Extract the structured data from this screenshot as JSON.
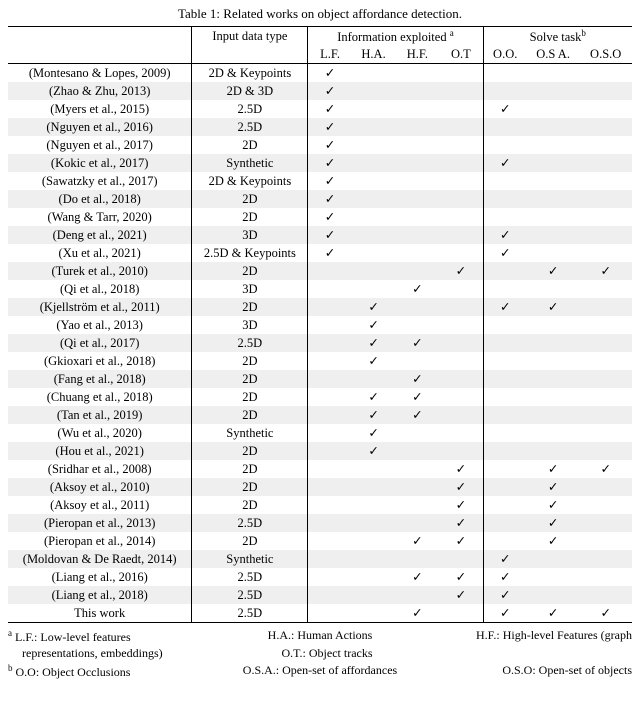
{
  "caption": "Table 1: Related works on object affordance detection.",
  "header": {
    "group1": "Input data type",
    "group2": "Information exploited",
    "group2_sup": "a",
    "group3": "Solve task",
    "group3_sup": "b",
    "c_lf": "L.F.",
    "c_ha": "H.A.",
    "c_hf": "H.F.",
    "c_ot": "O.T",
    "c_oo": "O.O.",
    "c_osa": "O.S A.",
    "c_oso": "O.S.O"
  },
  "chart_data": {
    "type": "table",
    "columns": [
      "reference",
      "input",
      "LF",
      "HA",
      "HF",
      "OT",
      "OO",
      "OSA",
      "OSO"
    ],
    "rows": [
      {
        "reference": "(Montesano & Lopes, 2009)",
        "input": "2D & Keypoints",
        "LF": true,
        "HA": false,
        "HF": false,
        "OT": false,
        "OO": false,
        "OSA": false,
        "OSO": false
      },
      {
        "reference": "(Zhao & Zhu, 2013)",
        "input": "2D & 3D",
        "LF": true,
        "HA": false,
        "HF": false,
        "OT": false,
        "OO": false,
        "OSA": false,
        "OSO": false
      },
      {
        "reference": "(Myers et al., 2015)",
        "input": "2.5D",
        "LF": true,
        "HA": false,
        "HF": false,
        "OT": false,
        "OO": true,
        "OSA": false,
        "OSO": false
      },
      {
        "reference": "(Nguyen et al., 2016)",
        "input": "2.5D",
        "LF": true,
        "HA": false,
        "HF": false,
        "OT": false,
        "OO": false,
        "OSA": false,
        "OSO": false
      },
      {
        "reference": "(Nguyen et al., 2017)",
        "input": "2D",
        "LF": true,
        "HA": false,
        "HF": false,
        "OT": false,
        "OO": false,
        "OSA": false,
        "OSO": false
      },
      {
        "reference": "(Kokic et al., 2017)",
        "input": "Synthetic",
        "LF": true,
        "HA": false,
        "HF": false,
        "OT": false,
        "OO": true,
        "OSA": false,
        "OSO": false
      },
      {
        "reference": "(Sawatzky et al., 2017)",
        "input": "2D & Keypoints",
        "LF": true,
        "HA": false,
        "HF": false,
        "OT": false,
        "OO": false,
        "OSA": false,
        "OSO": false
      },
      {
        "reference": "(Do et al., 2018)",
        "input": "2D",
        "LF": true,
        "HA": false,
        "HF": false,
        "OT": false,
        "OO": false,
        "OSA": false,
        "OSO": false
      },
      {
        "reference": "(Wang & Tarr, 2020)",
        "input": "2D",
        "LF": true,
        "HA": false,
        "HF": false,
        "OT": false,
        "OO": false,
        "OSA": false,
        "OSO": false
      },
      {
        "reference": "(Deng et al., 2021)",
        "input": "3D",
        "LF": true,
        "HA": false,
        "HF": false,
        "OT": false,
        "OO": true,
        "OSA": false,
        "OSO": false
      },
      {
        "reference": "(Xu et al., 2021)",
        "input": "2.5D & Keypoints",
        "LF": true,
        "HA": false,
        "HF": false,
        "OT": false,
        "OO": true,
        "OSA": false,
        "OSO": false
      },
      {
        "reference": "(Turek et al., 2010)",
        "input": "2D",
        "LF": false,
        "HA": false,
        "HF": false,
        "OT": true,
        "OO": false,
        "OSA": true,
        "OSO": true
      },
      {
        "reference": "(Qi et al., 2018)",
        "input": "3D",
        "LF": false,
        "HA": false,
        "HF": true,
        "OT": false,
        "OO": false,
        "OSA": false,
        "OSO": false
      },
      {
        "reference": "(Kjellström et al., 2011)",
        "input": "2D",
        "LF": false,
        "HA": true,
        "HF": false,
        "OT": false,
        "OO": true,
        "OSA": true,
        "OSO": false
      },
      {
        "reference": "(Yao et al., 2013)",
        "input": "3D",
        "LF": false,
        "HA": true,
        "HF": false,
        "OT": false,
        "OO": false,
        "OSA": false,
        "OSO": false
      },
      {
        "reference": "(Qi et al., 2017)",
        "input": "2.5D",
        "LF": false,
        "HA": true,
        "HF": true,
        "OT": false,
        "OO": false,
        "OSA": false,
        "OSO": false
      },
      {
        "reference": "(Gkioxari et al., 2018)",
        "input": "2D",
        "LF": false,
        "HA": true,
        "HF": false,
        "OT": false,
        "OO": false,
        "OSA": false,
        "OSO": false
      },
      {
        "reference": "(Fang et al., 2018)",
        "input": "2D",
        "LF": false,
        "HA": false,
        "HF": true,
        "OT": false,
        "OO": false,
        "OSA": false,
        "OSO": false
      },
      {
        "reference": "(Chuang et al., 2018)",
        "input": "2D",
        "LF": false,
        "HA": true,
        "HF": true,
        "OT": false,
        "OO": false,
        "OSA": false,
        "OSO": false
      },
      {
        "reference": "(Tan et al., 2019)",
        "input": "2D",
        "LF": false,
        "HA": true,
        "HF": true,
        "OT": false,
        "OO": false,
        "OSA": false,
        "OSO": false
      },
      {
        "reference": "(Wu et al., 2020)",
        "input": "Synthetic",
        "LF": false,
        "HA": true,
        "HF": false,
        "OT": false,
        "OO": false,
        "OSA": false,
        "OSO": false
      },
      {
        "reference": "(Hou et al., 2021)",
        "input": "2D",
        "LF": false,
        "HA": true,
        "HF": false,
        "OT": false,
        "OO": false,
        "OSA": false,
        "OSO": false
      },
      {
        "reference": "(Sridhar et al., 2008)",
        "input": "2D",
        "LF": false,
        "HA": false,
        "HF": false,
        "OT": true,
        "OO": false,
        "OSA": true,
        "OSO": true
      },
      {
        "reference": "(Aksoy et al., 2010)",
        "input": "2D",
        "LF": false,
        "HA": false,
        "HF": false,
        "OT": true,
        "OO": false,
        "OSA": true,
        "OSO": false
      },
      {
        "reference": "(Aksoy et al., 2011)",
        "input": "2D",
        "LF": false,
        "HA": false,
        "HF": false,
        "OT": true,
        "OO": false,
        "OSA": true,
        "OSO": false
      },
      {
        "reference": "(Pieropan et al., 2013)",
        "input": "2.5D",
        "LF": false,
        "HA": false,
        "HF": false,
        "OT": true,
        "OO": false,
        "OSA": true,
        "OSO": false
      },
      {
        "reference": "(Pieropan et al., 2014)",
        "input": "2D",
        "LF": false,
        "HA": false,
        "HF": true,
        "OT": true,
        "OO": false,
        "OSA": true,
        "OSO": false
      },
      {
        "reference": "(Moldovan & De Raedt, 2014)",
        "input": "Synthetic",
        "LF": false,
        "HA": false,
        "HF": false,
        "OT": false,
        "OO": true,
        "OSA": false,
        "OSO": false
      },
      {
        "reference": "(Liang et al., 2016)",
        "input": "2.5D",
        "LF": false,
        "HA": false,
        "HF": true,
        "OT": true,
        "OO": true,
        "OSA": false,
        "OSO": false
      },
      {
        "reference": "(Liang et al., 2018)",
        "input": "2.5D",
        "LF": false,
        "HA": false,
        "HF": false,
        "OT": true,
        "OO": true,
        "OSA": false,
        "OSO": false
      },
      {
        "reference": "This work",
        "input": "2.5D",
        "LF": false,
        "HA": false,
        "HF": true,
        "OT": false,
        "OO": true,
        "OSA": true,
        "OSO": true
      }
    ]
  },
  "footnotes": {
    "a_left": "L.F.:  Low-level features",
    "a_mid": "H.A.:  Human Actions",
    "a_right": "H.F.:  High-level Features (graph",
    "a_line2_left": "representations, embeddings)",
    "a_line2_right": "O.T.:  Object tracks",
    "b_left": "O.O: Object Occlusions",
    "b_mid": "O.S.A.:  Open-set of affordances",
    "b_right": "O.S.O: Open-set of objects",
    "sup_a": "a",
    "sup_b": "b"
  }
}
